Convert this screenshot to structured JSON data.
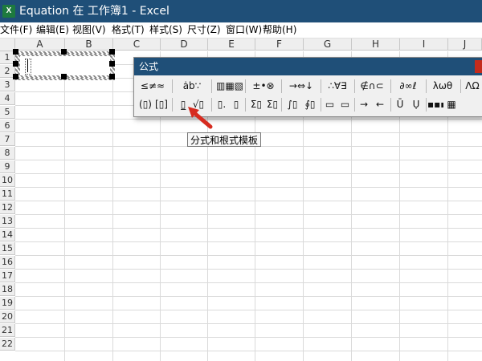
{
  "window": {
    "title": "Equation 在 工作簿1 - Excel",
    "app_icon": "excel-icon",
    "icon_letter": "X"
  },
  "menu": [
    "文件(F)",
    "编辑(E)",
    "视图(V)",
    "格式(T)",
    "样式(S)",
    "尺寸(Z)",
    "窗口(W)",
    "帮助(H)"
  ],
  "sheet": {
    "columns": [
      "A",
      "B",
      "C",
      "D",
      "E",
      "F",
      "G",
      "H",
      "I",
      "J"
    ],
    "rows": [
      "1",
      "2",
      "3",
      "4",
      "5",
      "6",
      "7",
      "8",
      "9",
      "10",
      "11",
      "12",
      "13",
      "14",
      "15",
      "16",
      "17",
      "18",
      "19",
      "20",
      "21",
      "22"
    ]
  },
  "palette": {
    "title": "公式",
    "row1": [
      "≤≠≈",
      "ȧb∵",
      "▥▦▧",
      "±•⊗",
      "→⇔↓",
      "∴∀∃",
      "∉∩⊂",
      "∂∞ℓ",
      "λωθ",
      "ΛΩ"
    ],
    "row2": [
      "(▯)",
      "[▯]",
      "▯̲",
      "√▯",
      "▯.",
      "▯",
      "Σ▯",
      "Σ▯",
      "∫▯",
      "∮▯",
      "▭",
      "▭",
      "→",
      "←",
      "Ū",
      "Ụ",
      "▪▪▪",
      "▦"
    ],
    "icons_row1": [
      "relations-icon",
      "spaces-ellipses-icon",
      "embellishments-icon",
      "operators-icon",
      "arrows-icon",
      "logic-icon",
      "set-theory-icon",
      "misc-symbols-icon",
      "greek-lower-icon",
      "greek-upper-icon"
    ],
    "icons_row2": [
      "fence-paren-icon",
      "fence-bracket-icon",
      "fraction-template-icon",
      "radical-template-icon",
      "subscript-icon",
      "superscript-icon",
      "summation-icon",
      "summation-limits-icon",
      "integral-icon",
      "contour-integral-icon",
      "underbar-icon",
      "overbar-icon",
      "arrow-right-label-icon",
      "arrow-left-label-icon",
      "product-icon",
      "coproduct-icon",
      "matrix-row-icon",
      "matrix-grid-icon"
    ]
  },
  "tooltip": "分式和根式模板",
  "colors": {
    "titlebar": "#1f4f78",
    "excel_green": "#1d7a3e",
    "arrow": "#d62b1f",
    "close": "#c42b1c"
  }
}
